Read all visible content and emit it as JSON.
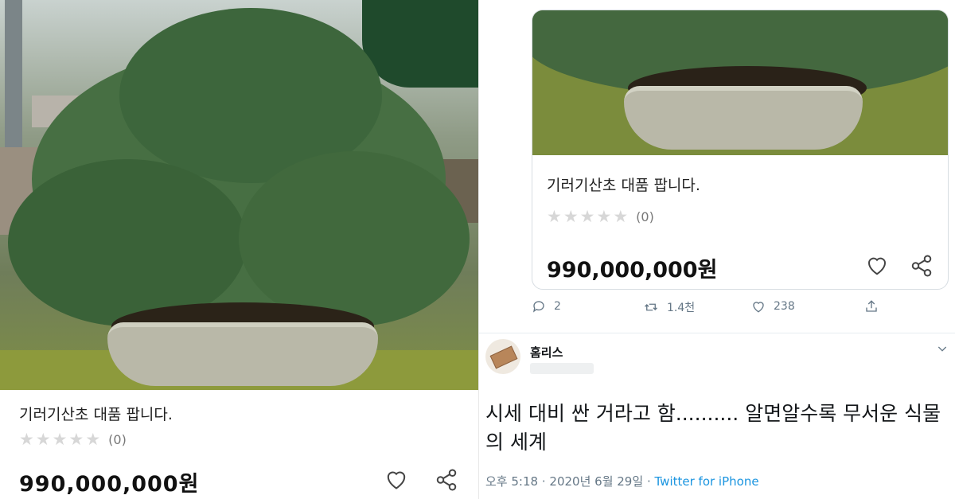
{
  "listing": {
    "title": "기러기산초 대품 팝니다.",
    "stars": [
      "★",
      "★",
      "★",
      "★",
      "★"
    ],
    "review_count": "(0)",
    "price": "990,000,000원"
  },
  "tweet_card": {
    "title": "기러기산초 대품 팝니다.",
    "stars": [
      "★",
      "★",
      "★",
      "★",
      "★"
    ],
    "review_count": "(0)",
    "price": "990,000,000원"
  },
  "tweet_actions": {
    "replies": "2",
    "retweets": "1.4천",
    "likes": "238"
  },
  "reply": {
    "username": "홈리스",
    "text": "시세 대비 싼 거라고 함.......... 알면알수록 무서운 식물의 세계",
    "time": "오후 5:18",
    "separator": "·",
    "date": "2020년 6월 29일",
    "source": "Twitter for iPhone"
  },
  "colors": {
    "text_secondary": "#657786",
    "link": "#1b95e0",
    "star_empty": "#d7d7d7"
  },
  "icons": [
    "heart-icon",
    "share-icon",
    "reply-icon",
    "retweet-icon",
    "like-icon",
    "upload-icon",
    "chevron-down-icon"
  ]
}
